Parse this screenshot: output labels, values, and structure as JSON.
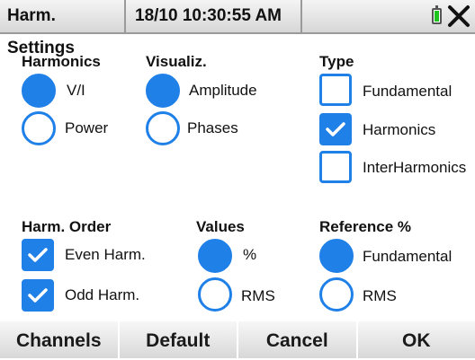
{
  "titlebar": {
    "app_title": "Harm. Settings",
    "datetime": "18/10 10:30:55 AM",
    "battery_icon": "battery-icon",
    "close_icon": "close-icon"
  },
  "harmonics": {
    "label": "Harmonics",
    "options": [
      {
        "label": "V/I",
        "selected": true
      },
      {
        "label": "Power",
        "selected": false
      }
    ]
  },
  "visualiz": {
    "label": "Visualiz.",
    "options": [
      {
        "label": "Amplitude",
        "selected": true
      },
      {
        "label": "Phases",
        "selected": false
      }
    ]
  },
  "type": {
    "label": "Type",
    "options": [
      {
        "label": "Fundamental",
        "checked": false
      },
      {
        "label": "Harmonics",
        "checked": true
      },
      {
        "label": "InterHarmonics",
        "checked": false
      }
    ]
  },
  "harm_order": {
    "label": "Harm. Order",
    "options": [
      {
        "label": "Even Harm.",
        "checked": true
      },
      {
        "label": "Odd Harm.",
        "checked": true
      }
    ]
  },
  "values": {
    "label": "Values",
    "options": [
      {
        "label": "%",
        "selected": true
      },
      {
        "label": "RMS",
        "selected": false
      }
    ]
  },
  "reference": {
    "label": "Reference %",
    "options": [
      {
        "label": "Fundamental",
        "selected": true
      },
      {
        "label": "RMS",
        "selected": false
      }
    ]
  },
  "buttons": {
    "channels": "Channels",
    "default": "Default",
    "cancel": "Cancel",
    "ok": "OK"
  },
  "colors": {
    "accent": "#1f80e8",
    "battery": "#1ec41e"
  }
}
